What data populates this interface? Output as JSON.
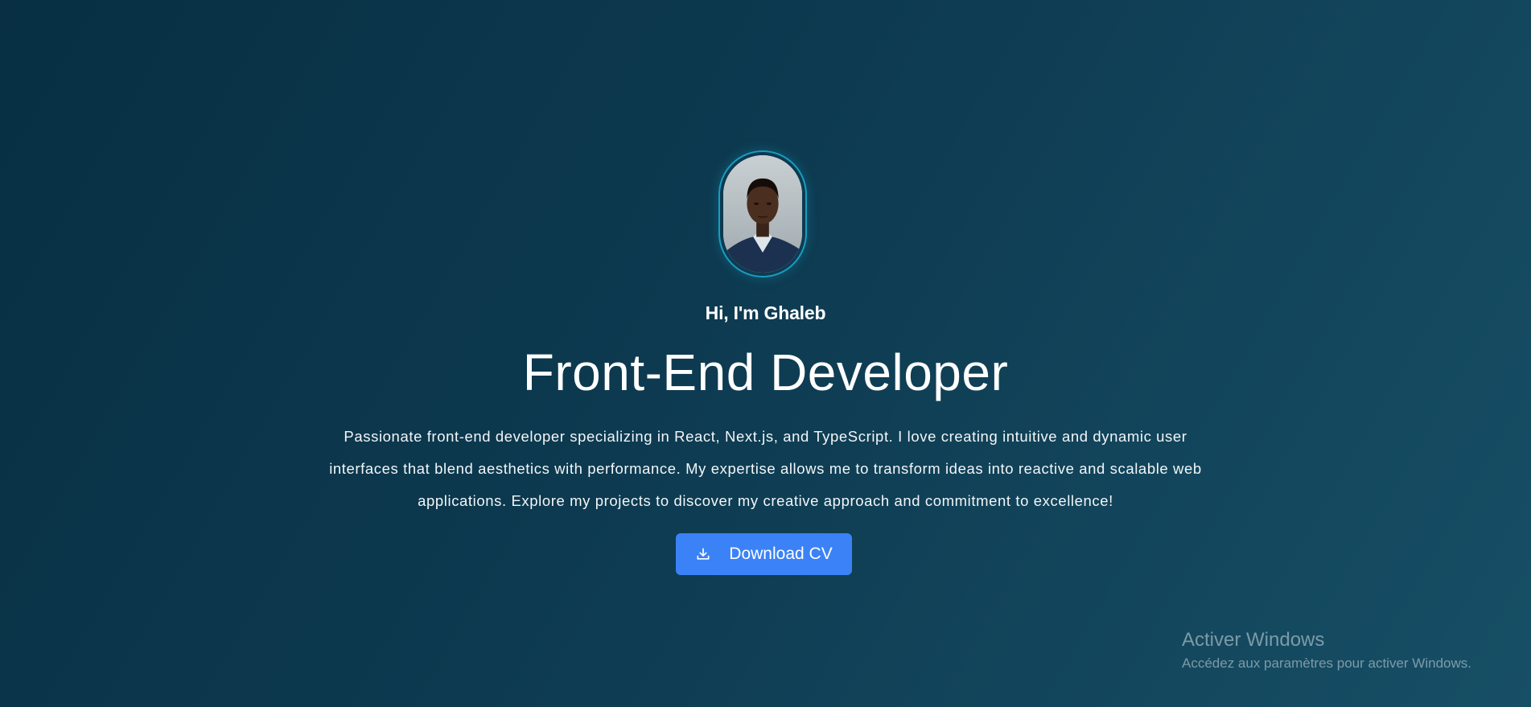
{
  "hero": {
    "greeting": "Hi, I'm Ghaleb",
    "title": "Front-End Developer",
    "description": "Passionate front-end developer specializing in React, Next.js, and TypeScript. I love creating intuitive and dynamic user interfaces that blend aesthetics with performance. My expertise allows me to transform ideas into reactive and scalable web applications. Explore my projects to discover my creative approach and commitment to excellence!",
    "cv_button_label": "Download CV",
    "cv_button_icon": "download-icon",
    "avatar_border_color": "#1a9cc0",
    "button_color": "#3b82f6"
  },
  "watermark": {
    "title": "Activer Windows",
    "subtitle": "Accédez aux paramètres pour activer Windows."
  }
}
